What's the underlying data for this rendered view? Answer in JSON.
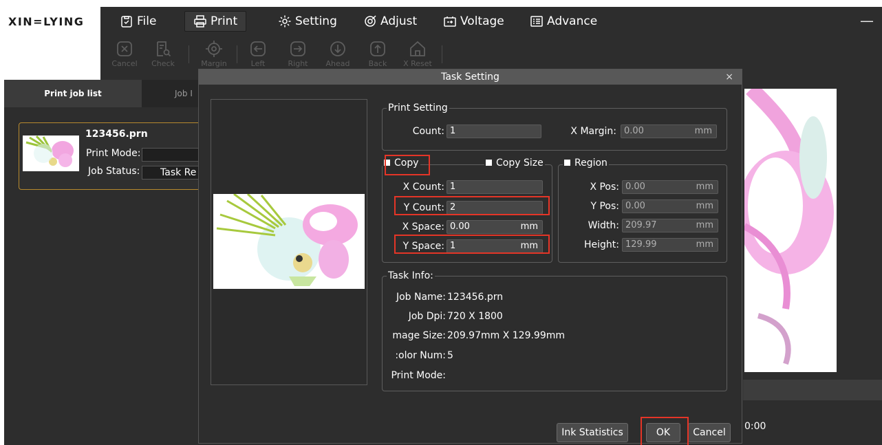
{
  "app": {
    "logo": "XIN=LYING",
    "minimize": "—"
  },
  "menu": [
    {
      "label": "File",
      "icon": "clipboard-icon"
    },
    {
      "label": "Print",
      "icon": "printer-icon"
    },
    {
      "label": "Setting",
      "icon": "gear-icon"
    },
    {
      "label": "Adjust",
      "icon": "target-icon"
    },
    {
      "label": "Voltage",
      "icon": "battery-icon"
    },
    {
      "label": "Advance",
      "icon": "list-icon"
    }
  ],
  "toolbar": [
    {
      "label": "Cancel",
      "icon": "cancel-icon"
    },
    {
      "label": "Check",
      "icon": "check-doc-icon"
    },
    {
      "label": "Margin",
      "icon": "crosshair-icon"
    },
    {
      "label": "Left",
      "icon": "arrow-left-icon"
    },
    {
      "label": "Right",
      "icon": "arrow-right-icon"
    },
    {
      "label": "Ahead",
      "icon": "arrow-down-icon"
    },
    {
      "label": "Back",
      "icon": "arrow-up-icon"
    },
    {
      "label": "X Reset",
      "icon": "home-icon"
    }
  ],
  "left_panel": {
    "tabs": [
      "Print job list",
      "Job I"
    ],
    "job": {
      "name": "123456.prn",
      "print_mode_label": "Print Mode:",
      "print_mode_value": "",
      "job_status_label": "Job Status:",
      "job_status_value": "Task Re"
    }
  },
  "right_panel": {
    "time": "0:00"
  },
  "dialog": {
    "title": "Task Setting",
    "close": "×",
    "print_setting": {
      "title": "Print Setting",
      "count_label": "Count:",
      "count_value": "1",
      "x_margin_label": "X Margin:",
      "x_margin_value": "0.00",
      "x_margin_unit": "mm"
    },
    "copy": {
      "title": "Copy",
      "copy_size_label": "Copy Size",
      "x_count_label": "X Count:",
      "x_count_value": "1",
      "y_count_label": "Y Count:",
      "y_count_value": "2",
      "x_space_label": "X Space:",
      "x_space_value": "0.00",
      "x_space_unit": "mm",
      "y_space_label": "Y Space:",
      "y_space_value": "1",
      "y_space_unit": "mm"
    },
    "region": {
      "title": "Region",
      "x_pos_label": "X Pos:",
      "x_pos_value": "0.00",
      "y_pos_label": "Y Pos:",
      "y_pos_value": "0.00",
      "width_label": "Width:",
      "width_value": "209.97",
      "height_label": "Height:",
      "height_value": "129.99",
      "unit": "mm"
    },
    "task_info": {
      "title": "Task Info:",
      "job_name_label": "Job Name:",
      "job_name_value": "123456.prn",
      "job_dpi_label": "Job Dpi:",
      "job_dpi_value": "720 X 1800",
      "image_size_label": "mage Size:",
      "image_size_value": "209.97mm X 129.99mm",
      "color_num_label": ":olor Num:",
      "color_num_value": "5",
      "print_mode_label": "Print Mode:",
      "print_mode_value": ""
    },
    "buttons": {
      "ink": "Ink Statistics",
      "ok": "OK",
      "cancel": "Cancel"
    }
  },
  "colors": {
    "highlight": "#e53527",
    "job_card_border": "#b88a2e"
  }
}
